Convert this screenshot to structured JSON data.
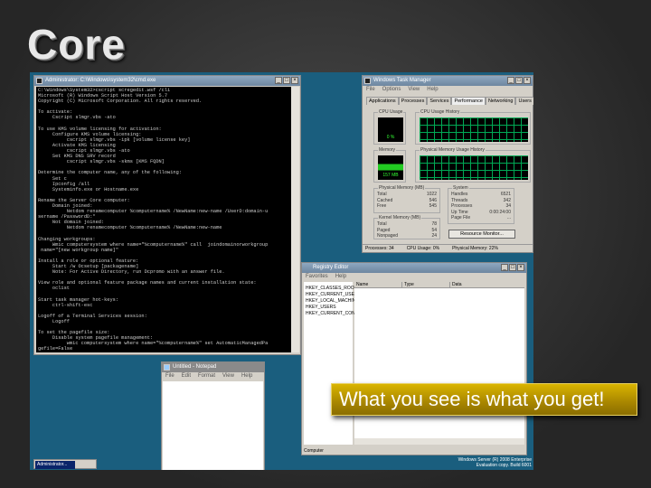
{
  "slide": {
    "title": "Core",
    "callout": "What you see is what you get!"
  },
  "cmd": {
    "title": "Administrator: C:\\Windows\\system32\\cmd.exe",
    "text": "C:\\Windows\\System32>cscript scregedit.wsf /cli\nMicrosoft (R) Windows Script Host Version 5.7\nCopyright (C) Microsoft Corporation. All rights reserved.\n\nTo activate:\n     Cscript slmgr.vbs -ato\n\nTo use KMS volume licensing for activation:\n     Configure KMS volume licensing:\n          cscript slmgr.vbs -ipk [volume license key]\n     Activate KMS licensing\n          cscript slmgr.vbs -ato\n     Set KMS DNS SRV record\n          cscript slmgr.vbs -skms [KMS FQDN]\n\nDetermine the computer name, any of the following:\n     Set c\n     Ipconfig /all\n     Systeminfo.exe or Hostname.exe\n\nRename the Server Core computer:\n     Domain joined:\n          Netdom renamecomputer %computername% /NewName:new-name /UserD:domain-u\nsername /PasswordD:*\n     Not domain joined:\n          Netdom renamecomputer %computername% /NewName:new-name\n\nChanging workgroups:\n     Wmic computersystem where name=\"%computername%\" call  joindomainorworkgroup\n name=\"[new workgroup name]\"\n\nInstall a role or optional feature:\n     Start /w Ocsetup [packagename]\n     Note: For Active Directory, run Dcpromo with an answer file.\n\nView role and optional feature package names and current installation state:\n     oclist\n\nStart task manager hot-keys:\n     ctrl-shift-esc\n\nLogoff of a Terminal Services session:\n     Logoff\n\nTo set the pagefile size:\n     Disable system pagefile management:\n          wmic computersystem where name=\"%computername%\" set AutomaticManagedPa\ngefile=False\n     Configure the pagefile:\n          wmic pagefileset where name=\"C:\\\\pagefile.sys\" set InitialSize=500,Max\nimumSize=1000\n\nConfigure the timezone, date, or time:\n     control timedate.cpl\n\nConfigure regional and language options:"
  },
  "taskmgr": {
    "title": "Windows Task Manager",
    "menu": [
      "File",
      "Options",
      "View",
      "Help"
    ],
    "tabs": [
      "Applications",
      "Processes",
      "Services",
      "Performance",
      "Networking",
      "Users"
    ],
    "cpu_label": "CPU Usage",
    "cpu_value": "0 %",
    "cpu_history_label": "CPU Usage History",
    "mem_label": "Memory",
    "mem_value": "157 MB",
    "mem_history_label": "Physical Memory Usage History",
    "physical": {
      "label": "Physical Memory (MB)",
      "rows": [
        [
          "Total",
          "1022"
        ],
        [
          "Cached",
          "546"
        ],
        [
          "Free",
          "545"
        ]
      ]
    },
    "kernel": {
      "label": "Kernel Memory (MB)",
      "rows": [
        [
          "Total",
          "78"
        ],
        [
          "Paged",
          "54"
        ],
        [
          "Nonpaged",
          "24"
        ]
      ]
    },
    "system": {
      "label": "System",
      "rows": [
        [
          "Handles",
          "6521"
        ],
        [
          "Threads",
          "342"
        ],
        [
          "Processes",
          "34"
        ],
        [
          "Up Time",
          "0:00:24:00"
        ],
        [
          "Page File",
          "..."
        ]
      ]
    },
    "resource_button": "Resource Monitor...",
    "status": [
      "Processes: 34",
      "CPU Usage: 0%",
      "Physical Memory: 22%"
    ]
  },
  "regedit": {
    "title": "Registry Editor",
    "menu": [
      "Favorites",
      "Help"
    ],
    "keys": [
      "HKEY_CLASSES_ROOT",
      "HKEY_CURRENT_USER",
      "HKEY_LOCAL_MACHINE",
      "HKEY_USERS",
      "HKEY_CURRENT_CONFIG"
    ],
    "columns": [
      "Name",
      "Type",
      "Data"
    ],
    "status": "Computer"
  },
  "notepad": {
    "title": "Untitled - Notepad",
    "menu": [
      "File",
      "Edit",
      "Format",
      "View",
      "Help"
    ]
  },
  "taskbar": {
    "item": "Administrator..."
  },
  "watermark": [
    "Windows Server (R) 2008 Enterprise",
    "Evaluation copy. Build 6001"
  ],
  "colors": {
    "desktop": "#1a5e7e",
    "callout": "#c9a400"
  }
}
